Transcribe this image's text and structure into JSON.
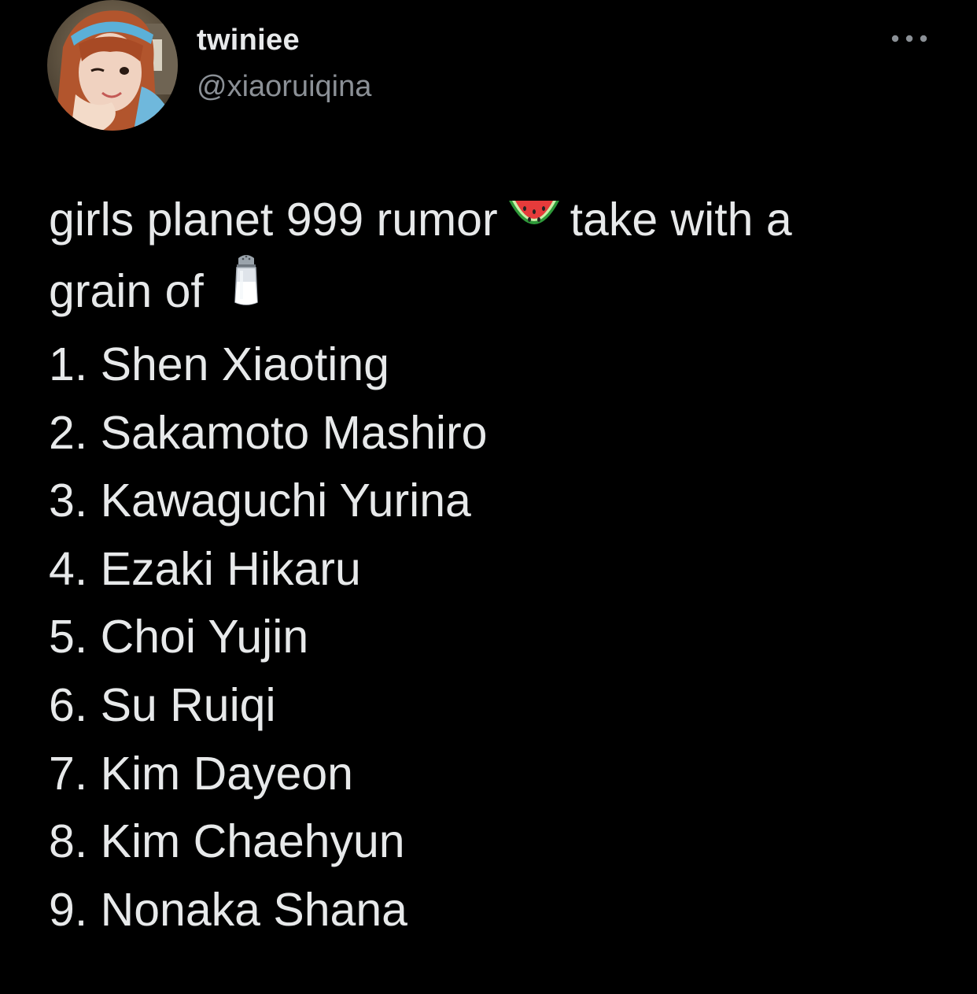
{
  "tweet": {
    "author": {
      "display_name": "twiniee",
      "handle": "@xiaoruiqina"
    },
    "more_menu_icon": "more-horizontal-icon",
    "text": {
      "line1_a": "girls planet 999 rumor",
      "emoji1": "watermelon-emoji",
      "line1_b": "take with a",
      "line2_a": "grain of",
      "emoji2": "salt-emoji"
    },
    "list": [
      "1. Shen Xiaoting",
      "2. Sakamoto Mashiro",
      "3. Kawaguchi Yurina",
      "4. Ezaki Hikaru",
      "5. Choi Yujin",
      "6. Su Ruiqi",
      "7. Kim Dayeon",
      "8. Kim Chaehyun",
      "9. Nonaka Shana"
    ]
  },
  "colors": {
    "background": "#000000",
    "primary_text": "#e7e9ea",
    "secondary_text": "#8b9096"
  }
}
